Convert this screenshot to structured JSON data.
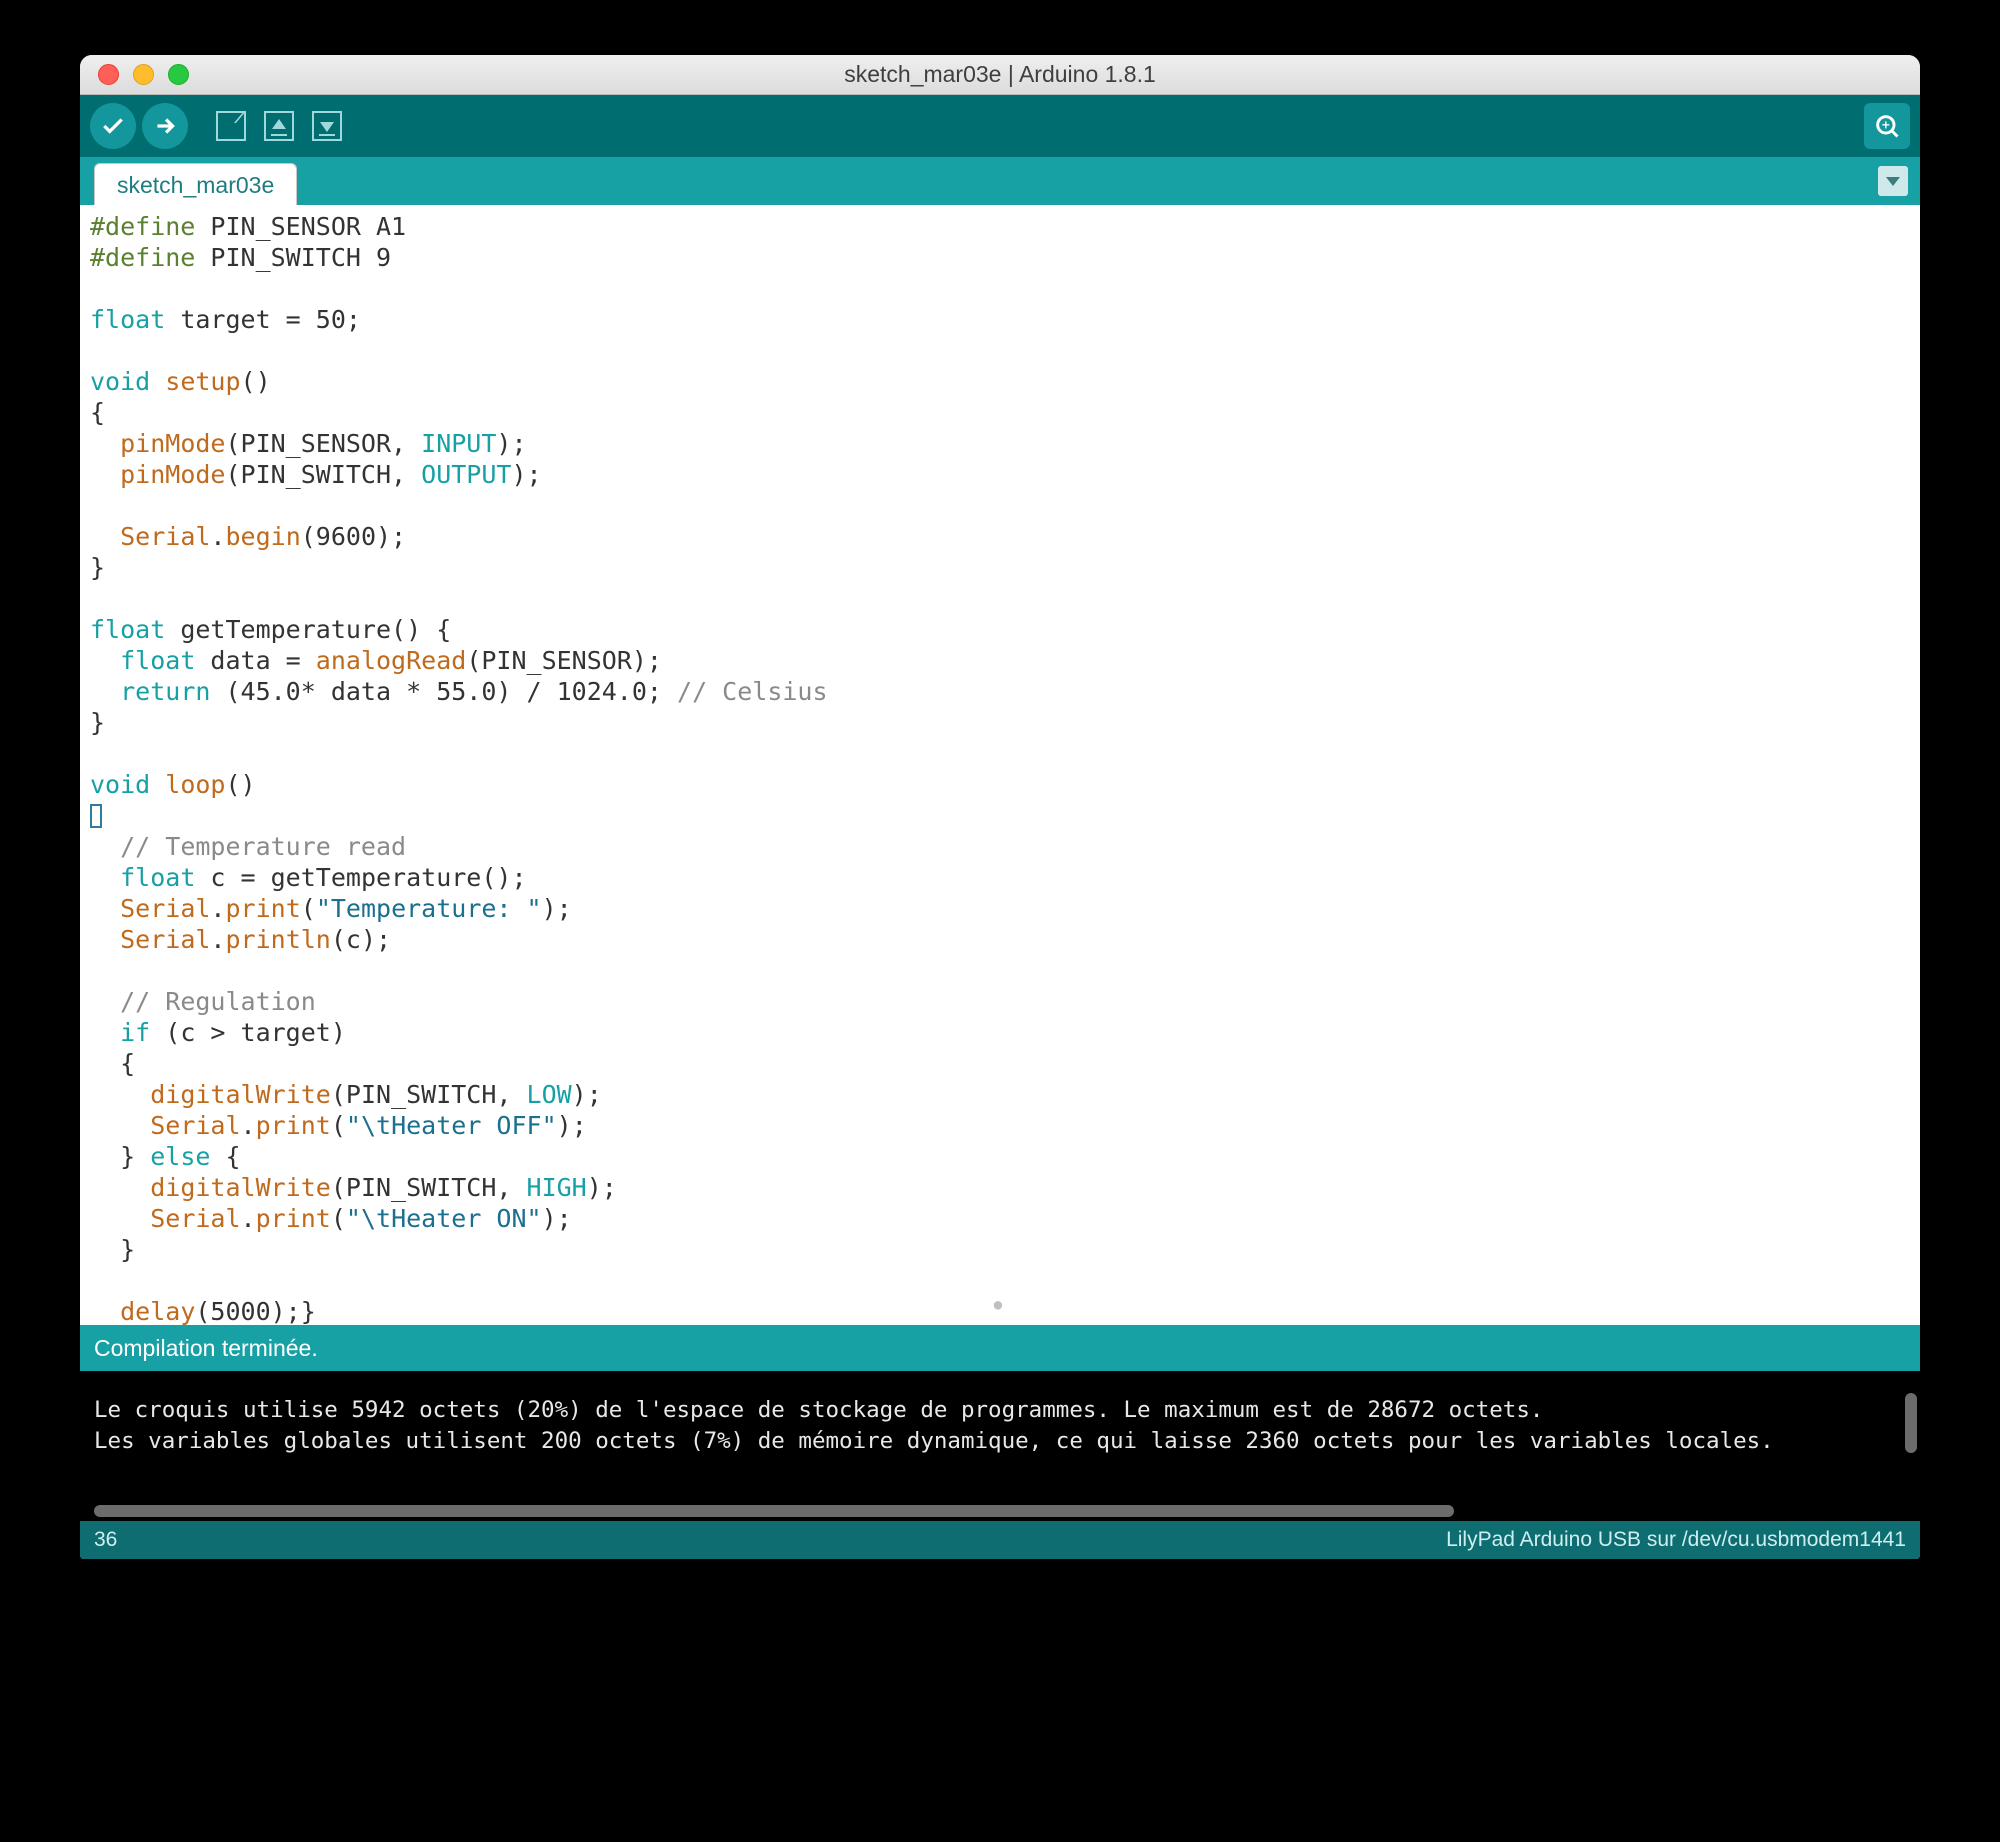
{
  "window": {
    "title": "sketch_mar03e | Arduino 1.8.1"
  },
  "tab": {
    "label": "sketch_mar03e"
  },
  "status": {
    "text": "Compilation terminée."
  },
  "footer": {
    "line": "36",
    "board": "LilyPad Arduino USB sur /dev/cu.usbmodem1441"
  },
  "code": {
    "l1a": "#define",
    "l1b": " PIN_SENSOR A1",
    "l2a": "#define",
    "l2b": " PIN_SWITCH 9",
    "l4a": "float",
    "l4b": " target = 50;",
    "l6a": "void",
    "l6b": " ",
    "l6c": "setup",
    "l6d": "()",
    "l7": "{",
    "l8a": "  ",
    "l8b": "pinMode",
    "l8c": "(PIN_SENSOR, ",
    "l8d": "INPUT",
    "l8e": ");",
    "l9a": "  ",
    "l9b": "pinMode",
    "l9c": "(PIN_SWITCH, ",
    "l9d": "OUTPUT",
    "l9e": ");",
    "l11a": "  ",
    "l11b": "Serial",
    "l11c": ".",
    "l11d": "begin",
    "l11e": "(9600);",
    "l12": "}",
    "l14a": "float",
    "l14b": " getTemperature() {",
    "l15a": "  ",
    "l15b": "float",
    "l15c": " data = ",
    "l15d": "analogRead",
    "l15e": "(PIN_SENSOR);",
    "l16a": "  ",
    "l16b": "return",
    "l16c": " (45.0* data * 55.0) / 1024.0; ",
    "l16d": "// Celsius",
    "l17": "}",
    "l19a": "void",
    "l19b": " ",
    "l19c": "loop",
    "l19d": "()",
    "l21a": "  ",
    "l21b": "// Temperature read",
    "l22a": "  ",
    "l22b": "float",
    "l22c": " c = getTemperature();",
    "l23a": "  ",
    "l23b": "Serial",
    "l23c": ".",
    "l23d": "print",
    "l23e": "(",
    "l23f": "\"Temperature: \"",
    "l23g": ");",
    "l24a": "  ",
    "l24b": "Serial",
    "l24c": ".",
    "l24d": "println",
    "l24e": "(c);",
    "l26a": "  ",
    "l26b": "// Regulation",
    "l27a": "  ",
    "l27b": "if",
    "l27c": " (c > target)",
    "l28": "  {",
    "l29a": "    ",
    "l29b": "digitalWrite",
    "l29c": "(PIN_SWITCH, ",
    "l29d": "LOW",
    "l29e": ");",
    "l30a": "    ",
    "l30b": "Serial",
    "l30c": ".",
    "l30d": "print",
    "l30e": "(",
    "l30f": "\"\\tHeater OFF\"",
    "l30g": ");",
    "l31a": "  } ",
    "l31b": "else",
    "l31c": " {",
    "l32a": "    ",
    "l32b": "digitalWrite",
    "l32c": "(PIN_SWITCH, ",
    "l32d": "HIGH",
    "l32e": ");",
    "l33a": "    ",
    "l33b": "Serial",
    "l33c": ".",
    "l33d": "print",
    "l33e": "(",
    "l33f": "\"\\tHeater ON\"",
    "l33g": ");",
    "l34": "  }",
    "l36a": "  ",
    "l36b": "delay",
    "l36c": "(5000);}"
  },
  "console": {
    "l1": "Le croquis utilise 5942 octets (20%) de l'espace de stockage de programmes. Le maximum est de 28672 octets.",
    "l2": "Les variables globales utilisent 200 octets (7%) de mémoire dynamique, ce qui laisse 2360 octets pour les variables locales."
  }
}
